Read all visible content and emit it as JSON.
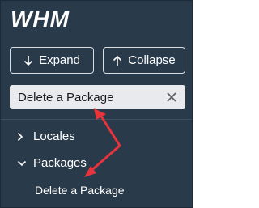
{
  "logo": {
    "text": "WHM",
    "color": "#ffffff"
  },
  "toolbar": {
    "expand_label": "Expand",
    "collapse_label": "Collapse",
    "expand_icon": "arrow-down-icon",
    "collapse_icon": "arrow-up-icon"
  },
  "search": {
    "value": "Delete a Package",
    "clear_icon": "close-icon"
  },
  "nav": {
    "items": [
      {
        "label": "Locales",
        "icon": "chevron-right-icon",
        "expanded": false
      },
      {
        "label": "Packages",
        "icon": "chevron-down-icon",
        "expanded": true,
        "children": [
          {
            "label": "Delete a Package"
          }
        ]
      }
    ]
  },
  "colors": {
    "sidebar_bg": "#293a4a",
    "search_bg": "#e8eaed",
    "annotation_arrow": "#e8333c"
  }
}
